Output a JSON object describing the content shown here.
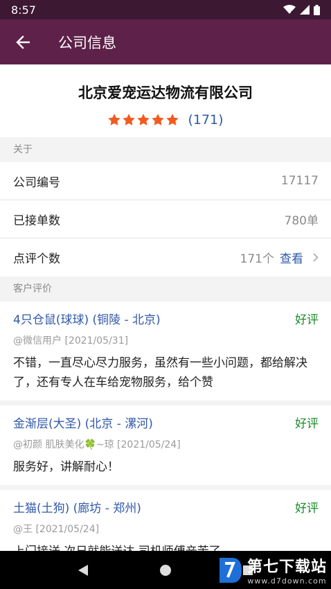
{
  "status_bar": {
    "time": "8:57"
  },
  "app_bar": {
    "title": "公司信息"
  },
  "company": {
    "name": "北京爱宠运达物流有限公司",
    "stars": 5,
    "review_count": "(171)"
  },
  "about": {
    "section_label": "关于",
    "rows": [
      {
        "label": "公司编号",
        "value": "17117"
      },
      {
        "label": "已接单数",
        "value": "780单"
      },
      {
        "label": "点评个数",
        "value": "171个",
        "link": "查看"
      }
    ]
  },
  "reviews": {
    "section_label": "客户评价",
    "items": [
      {
        "title": "4只仓鼠(球球) (铜陵 - 北京)",
        "tag": "好评",
        "meta": "@微信用户 [2021/05/31]",
        "text": "不错，一直尽心尽力服务，虽然有一些小问题，都给解决了，还有专人在车给宠物服务，给个赞"
      },
      {
        "title": "金渐层(大圣) (北京 - 漯河)",
        "tag": "好评",
        "meta": "@初颜 肌肤美化🍀~琼 [2021/05/24]",
        "text": "服务好，讲解耐心！"
      },
      {
        "title": "土猫(土狗) (廊坊 - 郑州)",
        "tag": "好评",
        "meta": "@王 [2021/05/24]",
        "text": "上门接送 次日就能送达 司机师傅辛苦了"
      }
    ]
  },
  "watermark": {
    "name": "第七下载站",
    "url": "www.d7down.com"
  },
  "colors": {
    "app_bar": "#5e2149",
    "status_bar": "#3d1833",
    "link": "#2f58a8",
    "positive": "#1b8a2a",
    "star": "#f25a1f"
  }
}
